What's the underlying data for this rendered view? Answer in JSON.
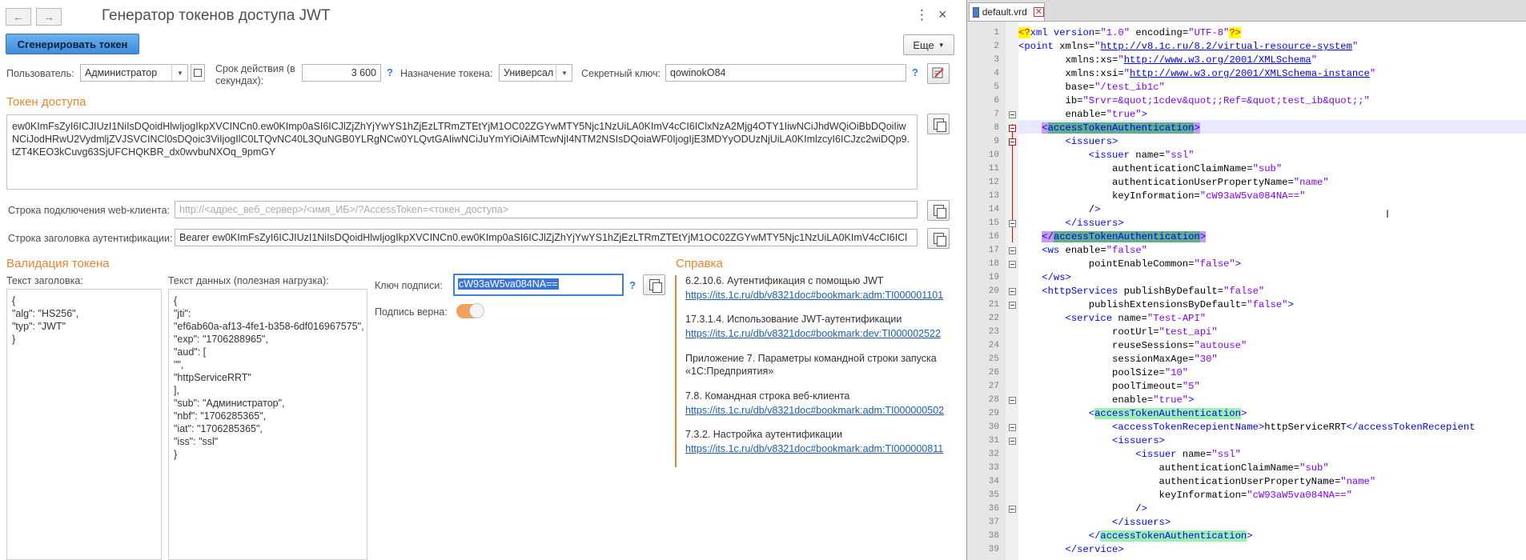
{
  "left": {
    "title": "Генератор токенов доступа JWT",
    "nav": {
      "back": "←",
      "forward": "→"
    },
    "menu_dots": "⋮",
    "close": "×",
    "generate_button": "Сгенерировать токен",
    "more_button": "Еще",
    "user_label": "Пользователь:",
    "user_value": "Администратор",
    "expiry_label_1": "Срок действия (в",
    "expiry_label_2": "секундах):",
    "expiry_value": "3 600",
    "purpose_label": "Назначение токена:",
    "purpose_value": "Универсал",
    "secret_label": "Секретный ключ:",
    "secret_value": "qowinokO84",
    "help_mark": "?",
    "access_token_title": "Токен доступа",
    "access_token_value": "ew0KImFsZyI6ICJIUzI1NiIsDQoidHlwIjogIkpXVCINCn0.ew0KImp0aSI6ICJlZjZhYjYwYS1hZjEzLTRmZTEtYjM1OC02ZGYwMTY5Njc1NzUiLA0KImV4cCI6IClxNzA2Mjg4OTY1IiwNCiJhdWQiOiBbDQoiIiwNCiJodHRwU2VydmljZVJSVCINCl0sDQoic3ViIjogIlC0LTQvNC40L3QuNGB0YLRgNCw0YLQvtGAIiwNCiJuYmYiOiAiMTcwNjI4NTM2NSIsDQoiaWF0IjogIjE3MDYyODUzNjUiLA0KImlzcyI6ICJzc2wiDQp9.tZT4KEO3kCuvg63SjUFCHQKBR_dx0wvbuNXOq_9pmGY",
    "web_client_label": "Строка подключения web-клиента:",
    "web_client_placeholder": "http://<адрес_веб_сервер>/<имя_ИБ>/?AccessToken=<токен_доступа>",
    "auth_header_label": "Строка заголовка аутентификации:",
    "auth_header_value": "Bearer ew0KImFsZyI6ICJIUzI1NiIsDQoidHlwIjogIkpXVCINCn0.ew0KImp0aSI6ICJlZjZhYjYwYS1hZjEzLTRmZTEtYjM1OC02ZGYwMTY5Njc1NzUiLA0KImV4cCI6ICl",
    "validation_title": "Валидация токена",
    "header_text_label": "Текст заголовка:",
    "header_text": "{\n\"alg\": \"HS256\",\n\"typ\": \"JWT\"\n}",
    "payload_label": "Текст данных (полезная нагрузка):",
    "payload_text": "{\n\"jti\":\n\"ef6ab60a-af13-4fe1-b358-6df016967575\",\n\"exp\": \"1706288965\",\n\"aud\": [\n\"\",\n\"httpServiceRRT\"\n],\n\"sub\": \"Администратор\",\n\"nbf\": \"1706285365\",\n\"iat\": \"1706285365\",\n\"iss\": \"ssl\"\n}",
    "sign_key_label": "Ключ подписи:",
    "sign_key_value": "cW93aW5va084NA==",
    "sign_valid_label": "Подпись верна:",
    "sign_valid": true,
    "reference_title": "Справка",
    "references": [
      {
        "title": "6.2.10.6. Аутентификация с помощью JWT",
        "link": "https://its.1c.ru/db/v8321doc#bookmark:adm:TI000001101"
      },
      {
        "title": "17.3.1.4. Использование JWT-аутентификации",
        "link": "https://its.1c.ru/db/v8321doc#bookmark:dev:TI000002522"
      },
      {
        "title": "Приложение 7. Параметры командной строки запуска «1С:Предприятия»",
        "link": ""
      },
      {
        "title": "7.8. Командная строка веб-клиента",
        "link": "https://its.1c.ru/db/v8321doc#bookmark:adm:TI000000502"
      },
      {
        "title": "7.3.2. Настройка аутентификации",
        "link": "https://its.1c.ru/db/v8321doc#bookmark:adm:TI000000811"
      }
    ]
  },
  "editor": {
    "tab_label": "default.vrd",
    "tab_close": "✕",
    "lines": [
      "<?xml version=\"1.0\" encoding=\"UTF-8\"?>",
      "<point xmlns=\"http://v8.1c.ru/8.2/virtual-resource-system\"",
      "        xmlns:xs=\"http://www.w3.org/2001/XMLSchema\"",
      "        xmlns:xsi=\"http://www.w3.org/2001/XMLSchema-instance\"",
      "        base=\"/test_ib1c\"",
      "        ib=\"Srvr=&quot;1cdev&quot;;Ref=&quot;test_ib&quot;;\"",
      "        enable=\"true\">",
      "    <accessTokenAuthentication>",
      "        <issuers>",
      "            <issuer name=\"ssl\"",
      "                authenticationClaimName=\"sub\"",
      "                authenticationUserPropertyName=\"name\"",
      "                keyInformation=\"cW93aW5va084NA==\"",
      "            />",
      "        </issuers>",
      "    </accessTokenAuthentication>",
      "    <ws enable=\"false\"",
      "            pointEnableCommon=\"false\">",
      "    </ws>",
      "    <httpServices publishByDefault=\"false\"",
      "            publishExtensionsByDefault=\"false\">",
      "        <service name=\"Test-API\"",
      "                rootUrl=\"test_api\"",
      "                reuseSessions=\"autouse\"",
      "                sessionMaxAge=\"30\"",
      "                poolSize=\"10\"",
      "                poolTimeout=\"5\"",
      "                enable=\"true\">",
      "            <accessTokenAuthentication>",
      "                <accessTokenRecepientName>httpServiceRRT</accessTokenRecepient",
      "                <issuers>",
      "                    <issuer name=\"ssl\"",
      "                        authenticationClaimName=\"sub\"",
      "                        authenticationUserPropertyName=\"name\"",
      "                        keyInformation=\"cW93aW5va084NA==\"",
      "                    />",
      "                </issuers>",
      "            </accessTokenAuthentication>",
      "        </service>"
    ]
  }
}
